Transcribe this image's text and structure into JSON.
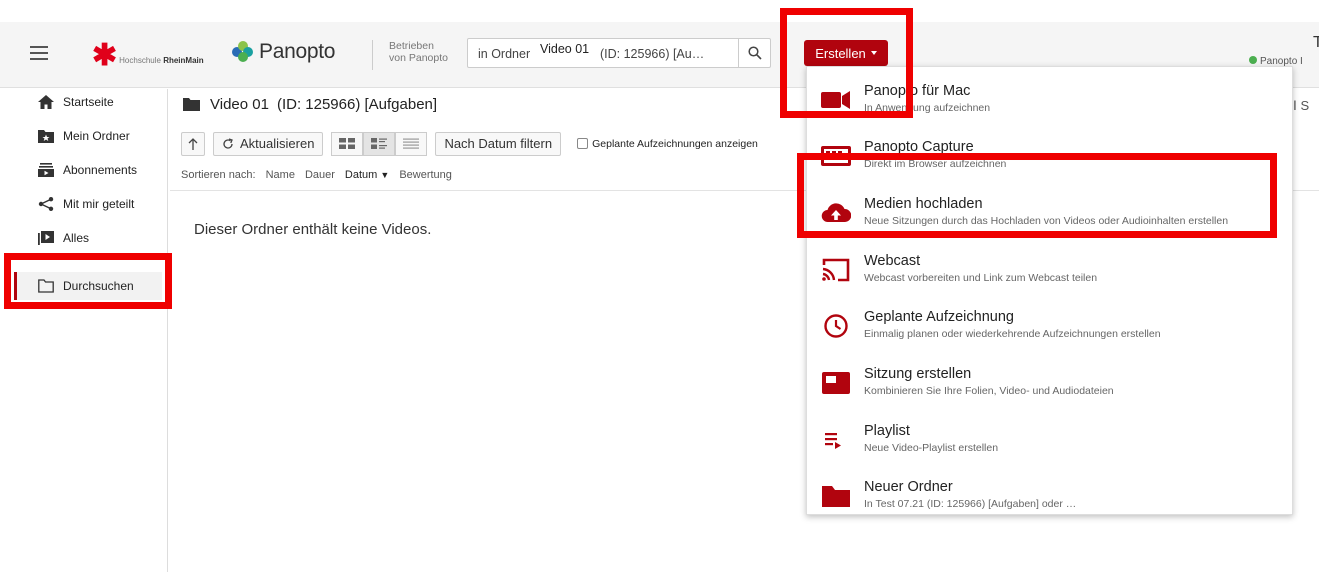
{
  "header": {
    "brand_text_prefix": "Hochschule",
    "brand_text_bold": "RheinMain",
    "product_name": "Panopto",
    "powered_line1": "Betrieben",
    "powered_line2": "von Panopto",
    "search_prefix": "in Ordner",
    "search_overlay": "Video 01",
    "search_rest": "(ID: 125966) [Au…",
    "create_button": "Erstellen",
    "user_initial": "T",
    "user_sub": "Panopto I"
  },
  "sidebar": {
    "items": [
      {
        "label": "Startseite",
        "icon": "home-icon"
      },
      {
        "label": "Mein Ordner",
        "icon": "star-folder-icon"
      },
      {
        "label": "Abonnements",
        "icon": "subscriptions-icon"
      },
      {
        "label": "Mit mir geteilt",
        "icon": "share-icon"
      },
      {
        "label": "Alles",
        "icon": "video-library-icon"
      },
      {
        "label": "Durchsuchen",
        "icon": "folder-outline-icon"
      }
    ]
  },
  "main": {
    "folder_name": "Video 01",
    "folder_meta": "(ID: 125966) [Aufgaben]",
    "toolbar": {
      "refresh_label": "Aktualisieren",
      "filter_label": "Nach Datum filtern",
      "scheduled_label": "Geplante Aufzeichnungen anzeigen"
    },
    "sort": {
      "label": "Sortieren nach:",
      "options": [
        "Name",
        "Dauer",
        "Datum",
        "Bewertung"
      ],
      "active": "Datum"
    },
    "empty_message": "Dieser Ordner enthält keine Videos.",
    "right_stub": "Ⅰ S"
  },
  "dropdown": {
    "items": [
      {
        "title": "Panopto für Mac",
        "subtitle": "In Anwendung aufzeichnen",
        "icon": "camera-icon"
      },
      {
        "title": "Panopto Capture",
        "subtitle": "Direkt im Browser aufzeichnen",
        "icon": "capture-icon"
      },
      {
        "title": "Medien hochladen",
        "subtitle": "Neue Sitzungen durch das Hochladen von Videos oder Audioinhalten erstellen",
        "icon": "cloud-upload-icon"
      },
      {
        "title": "Webcast",
        "subtitle": "Webcast vorbereiten und Link zum Webcast teilen",
        "icon": "cast-icon"
      },
      {
        "title": "Geplante Aufzeichnung",
        "subtitle": "Einmalig planen oder wiederkehrende Aufzeichnungen erstellen",
        "icon": "clock-icon"
      },
      {
        "title": "Sitzung erstellen",
        "subtitle": "Kombinieren Sie Ihre Folien, Video- und Audiodateien",
        "icon": "session-icon"
      },
      {
        "title": "Playlist",
        "subtitle": "Neue Video-Playlist erstellen",
        "icon": "playlist-icon"
      },
      {
        "title": "Neuer Ordner",
        "subtitle": "In Test 07.21 (ID: 125966) [Aufgaben] oder …",
        "icon": "folder-icon"
      }
    ]
  },
  "colors": {
    "accent": "#b1040e",
    "annotation": "#ef0000"
  }
}
